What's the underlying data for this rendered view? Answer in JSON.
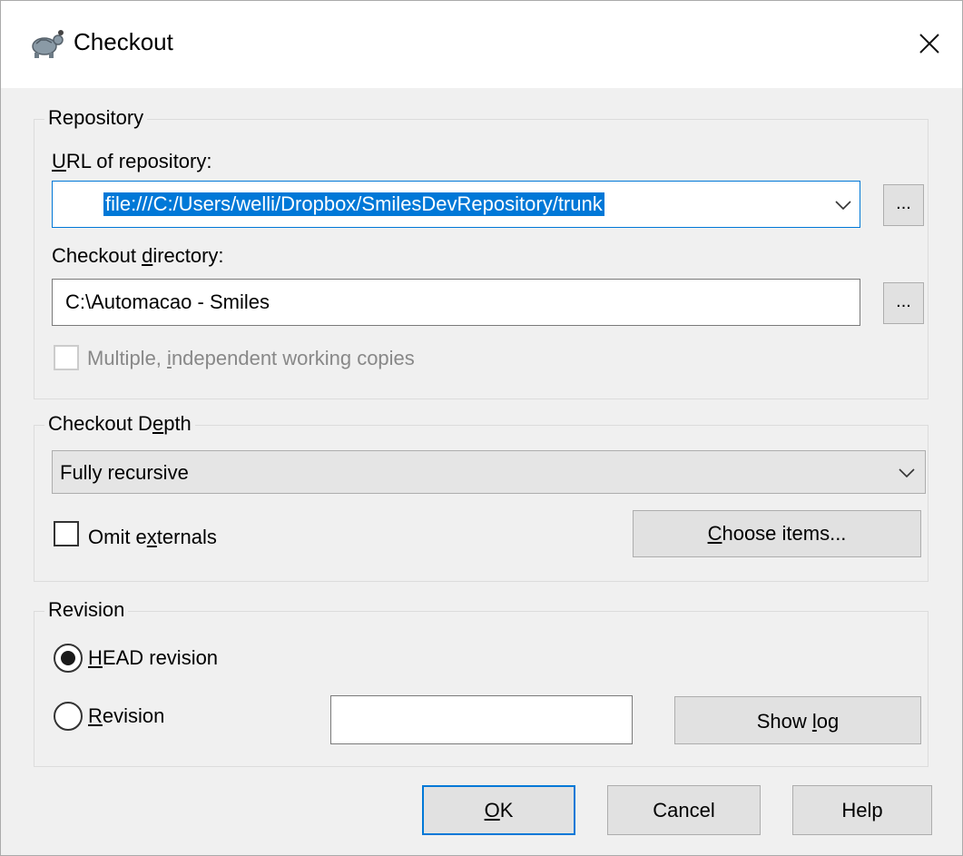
{
  "window": {
    "title": "Checkout",
    "icons": {
      "app": "tortoise-icon",
      "close": "close-icon"
    }
  },
  "repository": {
    "legend": "Repository",
    "url_label_accel": "U",
    "url_label_rest": "RL of repository:",
    "url_value": "file:///C:/Users/welli/Dropbox/SmilesDevRepository/trunk",
    "url_browse_label": "...",
    "dir_label_pre": "Checkout ",
    "dir_label_accel": "d",
    "dir_label_post": "irectory:",
    "dir_value": "C:\\Automacao - Smiles",
    "dir_browse_label": "...",
    "multiple_pre": "Multiple, ",
    "multiple_accel": "i",
    "multiple_post": "ndependent working copies",
    "multiple_checked": false,
    "multiple_enabled": false
  },
  "depth": {
    "legend_pre": "Checkout D",
    "legend_accel": "e",
    "legend_post": "pth",
    "selected": "Fully recursive",
    "omit_pre": "Omit e",
    "omit_accel": "x",
    "omit_post": "ternals",
    "omit_checked": false,
    "choose_accel": "C",
    "choose_rest": "hoose items..."
  },
  "revision": {
    "legend": "Revision",
    "head_accel": "H",
    "head_rest": "EAD revision",
    "head_selected": true,
    "rev_accel": "R",
    "rev_rest": "evision",
    "rev_value": "",
    "showlog_pre": "Show ",
    "showlog_accel": "l",
    "showlog_post": "og"
  },
  "footer": {
    "ok_accel": "O",
    "ok_rest": "K",
    "cancel": "Cancel",
    "help": "Help"
  },
  "colors": {
    "accent": "#0078d7",
    "background": "#f0f0f0",
    "button": "#e1e1e1"
  }
}
